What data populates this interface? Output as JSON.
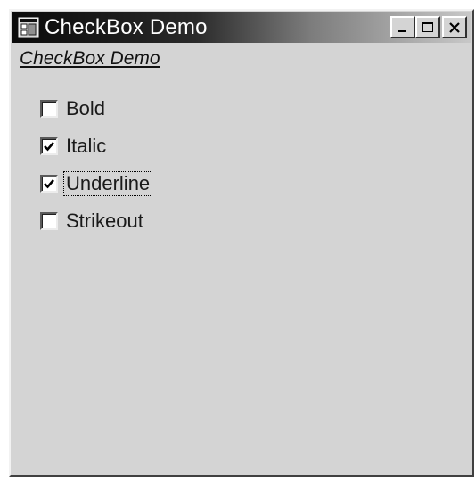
{
  "window": {
    "title": "CheckBox Demo",
    "controls": {
      "minimize": "minimize-icon",
      "maximize": "maximize-icon",
      "close": "close-icon"
    }
  },
  "form": {
    "label": "CheckBox Demo"
  },
  "checkboxes": [
    {
      "label": "Bold",
      "checked": false,
      "focused": false
    },
    {
      "label": "Italic",
      "checked": true,
      "focused": false
    },
    {
      "label": "Underline",
      "checked": true,
      "focused": true
    },
    {
      "label": "Strikeout",
      "checked": false,
      "focused": false
    }
  ]
}
